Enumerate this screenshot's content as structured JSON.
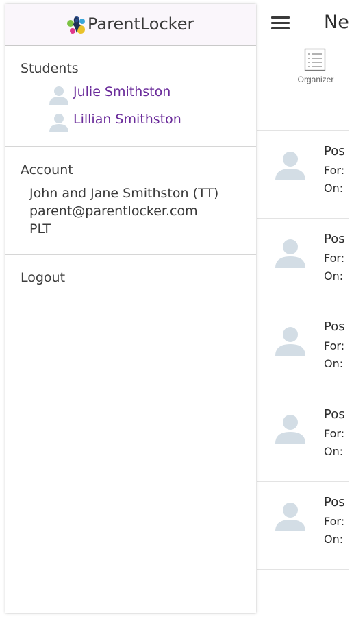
{
  "app": {
    "brand": "ParentLocker"
  },
  "main": {
    "title": "New",
    "tabs": [
      {
        "label": "Organizer",
        "icon": "list-icon"
      }
    ],
    "posts": [
      {
        "title": "Pos",
        "for": "For:",
        "on": "On:"
      },
      {
        "title": "Pos",
        "for": "For:",
        "on": "On:"
      },
      {
        "title": "Pos",
        "for": "For:",
        "on": "On:"
      },
      {
        "title": "Pos",
        "for": "For:",
        "on": "On:"
      },
      {
        "title": "Pos",
        "for": "For:",
        "on": "On:"
      }
    ]
  },
  "drawer": {
    "students_title": "Students",
    "students": [
      {
        "name": "Julie Smithston"
      },
      {
        "name": "Lillian Smithston"
      }
    ],
    "account_title": "Account",
    "account": {
      "name": "John and Jane Smithston (TT)",
      "email": "parent@parentlocker.com",
      "org": "PLT"
    },
    "logout_label": "Logout"
  },
  "colors": {
    "link": "#6a2b9a",
    "header_bg": "#faf6fb",
    "avatar": "#d3dde5"
  }
}
